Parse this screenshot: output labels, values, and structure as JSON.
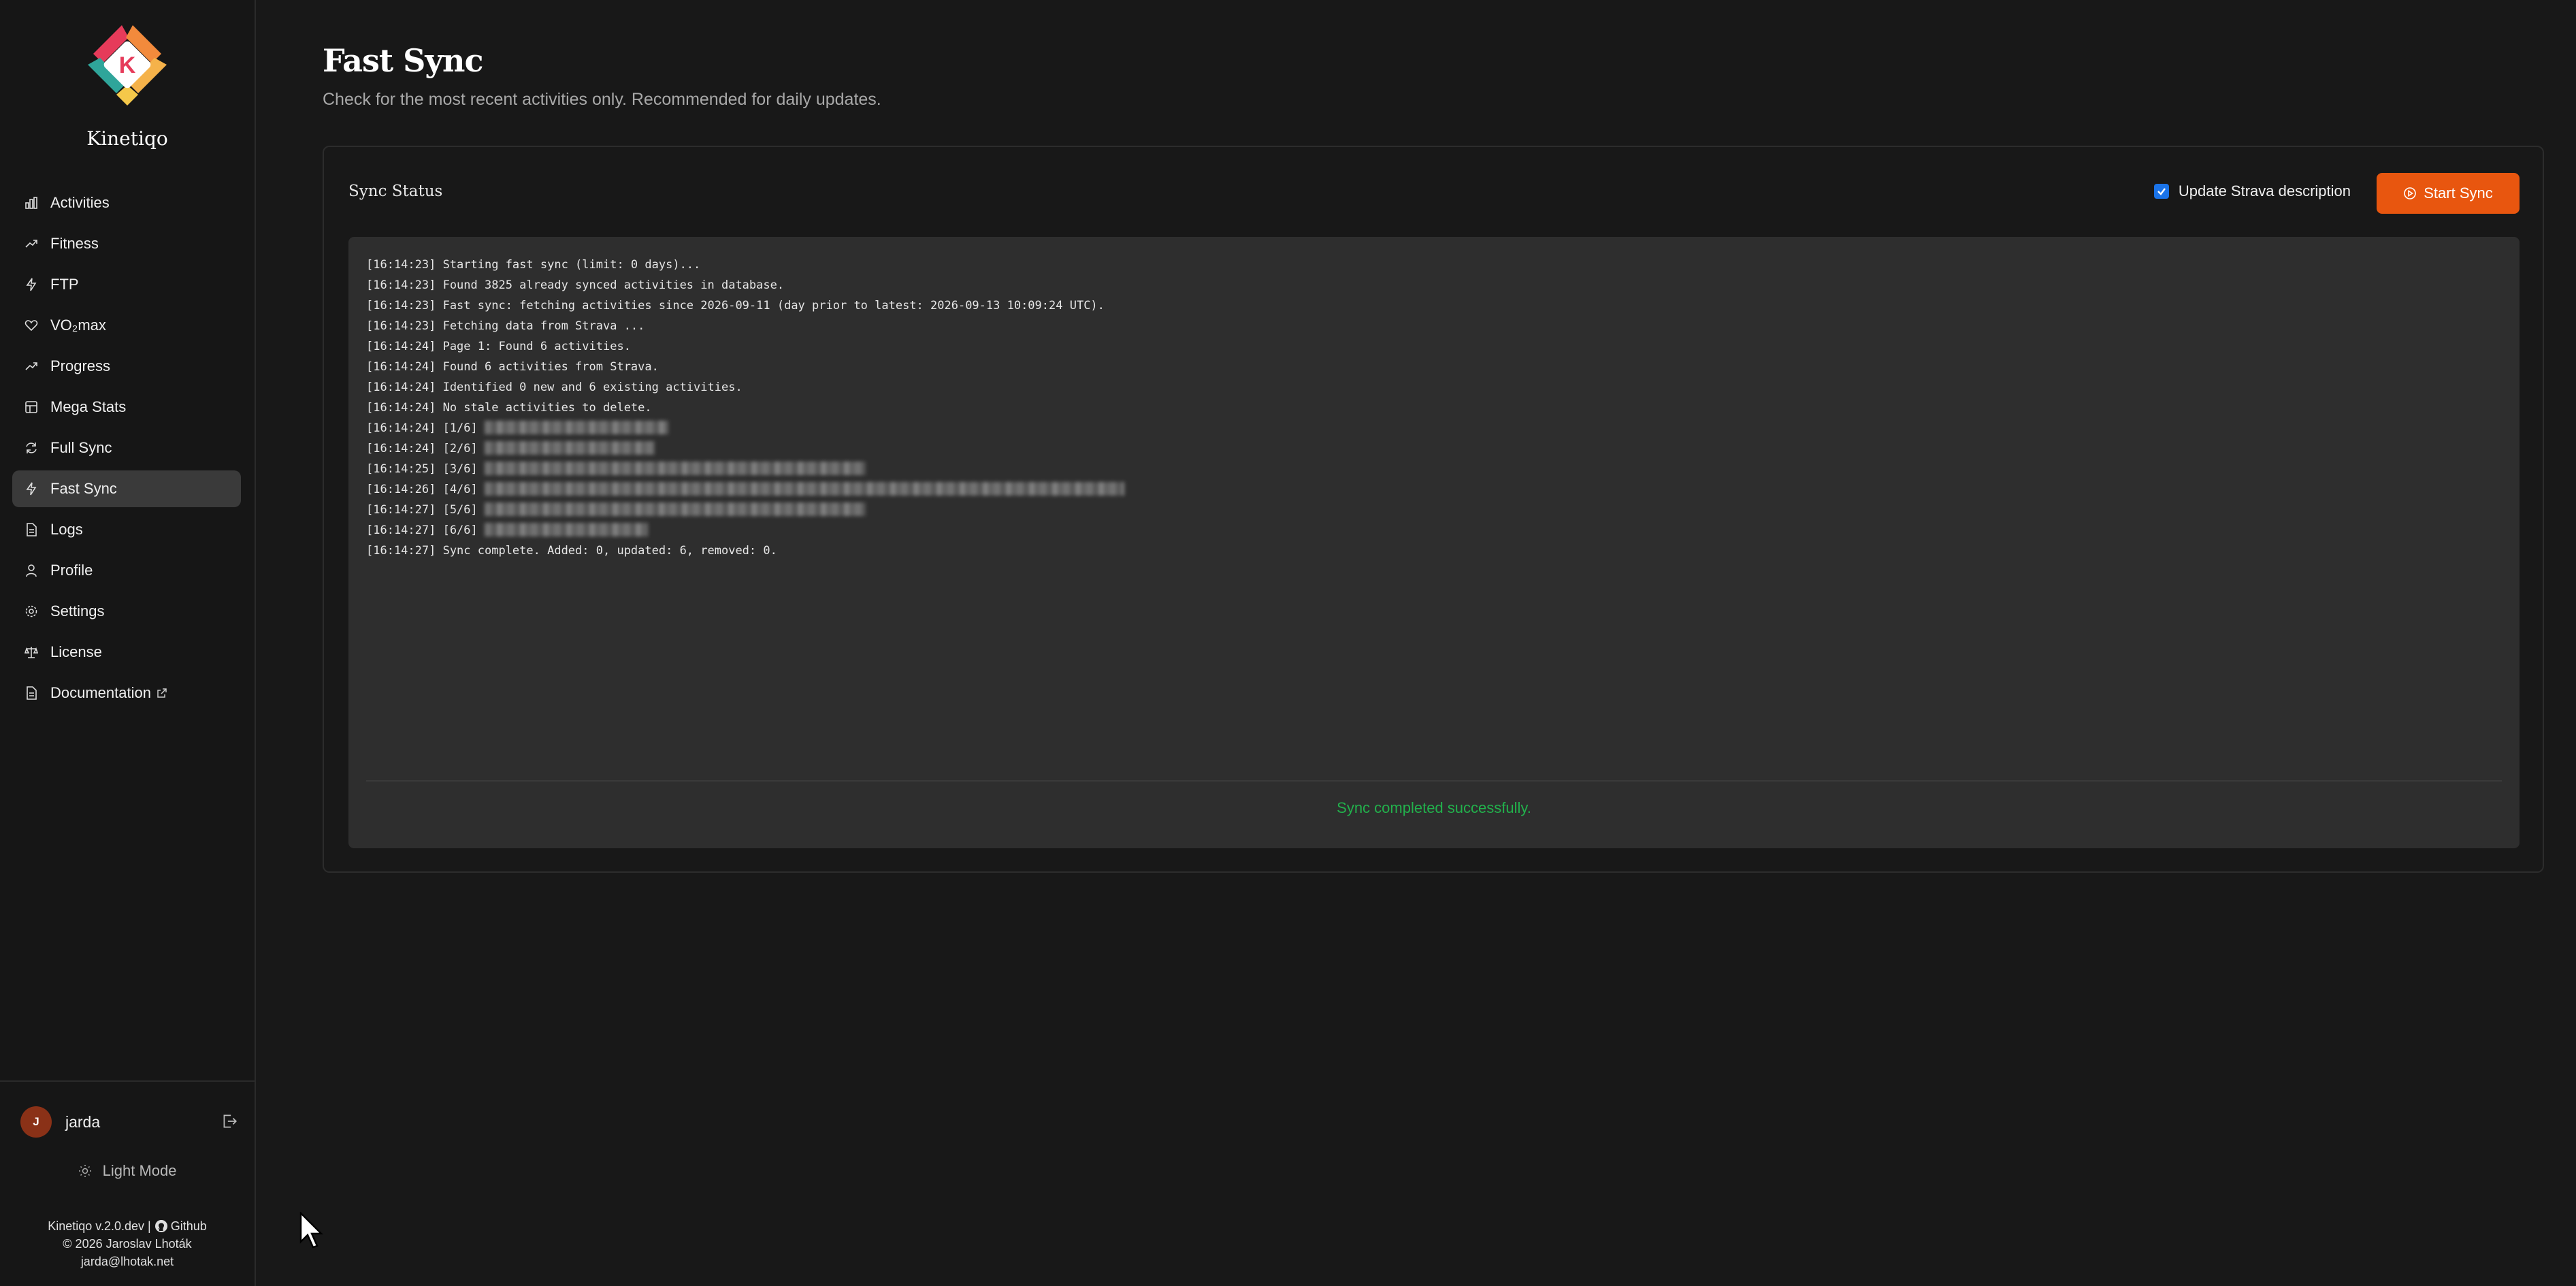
{
  "app": {
    "brand": "Kinetiqo",
    "logo_letter": "K"
  },
  "sidebar": {
    "items": [
      {
        "label": "Activities",
        "icon": "bar-chart-icon"
      },
      {
        "label": "Fitness",
        "icon": "trend-up-icon"
      },
      {
        "label": "FTP",
        "icon": "lightning-icon"
      },
      {
        "label": "VO₂max",
        "icon": "heart-icon"
      },
      {
        "label": "Progress",
        "icon": "trend-up-icon"
      },
      {
        "label": "Mega Stats",
        "icon": "grid-icon"
      },
      {
        "label": "Full Sync",
        "icon": "refresh-icon"
      },
      {
        "label": "Fast Sync",
        "icon": "lightning-icon"
      },
      {
        "label": "Logs",
        "icon": "file-icon"
      },
      {
        "label": "Profile",
        "icon": "user-icon"
      },
      {
        "label": "Settings",
        "icon": "gear-icon"
      },
      {
        "label": "License",
        "icon": "scale-icon"
      },
      {
        "label": "Documentation",
        "icon": "file-icon"
      }
    ],
    "active": "Fast Sync",
    "user": {
      "initial": "J",
      "name": "jarda"
    },
    "light_mode_label": "Light Mode",
    "footer": {
      "version": "Kinetiqo v.2.0.dev |",
      "github": "Github",
      "copyright": "© 2026 Jaroslav Lhoták",
      "email": "jarda@lhotak.net"
    }
  },
  "page": {
    "title": "Fast Sync",
    "subtitle": "Check for the most recent activities only. Recommended for daily updates."
  },
  "sync_card": {
    "title": "Sync Status",
    "checkbox_label": "Update Strava description",
    "checkbox_checked": true,
    "start_button": "Start Sync",
    "log": [
      "[16:14:23] Starting fast sync (limit: 0 days)...",
      "[16:14:23] Found 3825 already synced activities in database.",
      "[16:14:23] Fast sync: fetching activities since 2026-09-11 (day prior to latest: 2026-09-13 10:09:24 UTC).",
      "[16:14:23] Fetching data from Strava ...",
      "[16:14:24] Page 1: Found 6 activities.",
      "[16:14:24] Found 6 activities from Strava.",
      "[16:14:24] Identified 0 new and 6 existing activities.",
      "[16:14:24] No stale activities to delete.",
      "[16:14:24] [1/6]",
      "[16:14:24] [2/6]",
      "[16:14:25] [3/6]",
      "[16:14:26] [4/6]",
      "[16:14:27] [5/6]",
      "[16:14:27] [6/6]",
      "[16:14:27] Sync complete. Added: 0, updated: 6, removed: 0."
    ],
    "status_message": "Sync completed successfully.",
    "status_color": "#22b14c",
    "accent_color": "#e8560f"
  }
}
